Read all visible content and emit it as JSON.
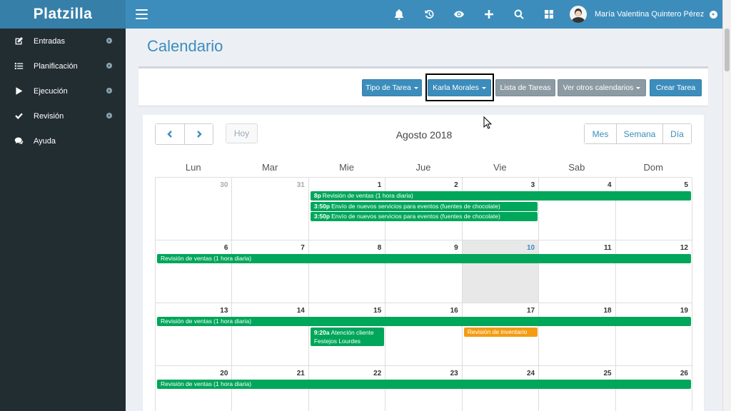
{
  "app": {
    "logo": "Platzilla"
  },
  "header": {
    "icons": [
      "bell-icon",
      "history-icon",
      "eye-icon",
      "plus-icon",
      "search-icon",
      "grid-icon"
    ],
    "user_name": "María Valentina Quintero Pérez"
  },
  "sidebar": {
    "items": [
      {
        "label": "Entradas",
        "icon": "edit-icon",
        "has_arrow": true
      },
      {
        "label": "Planificación",
        "icon": "list-icon",
        "has_arrow": true
      },
      {
        "label": "Ejecución",
        "icon": "play-icon",
        "has_arrow": true
      },
      {
        "label": "Revisión",
        "icon": "check-icon",
        "has_arrow": true
      },
      {
        "label": "Ayuda",
        "icon": "chat-icon",
        "has_arrow": false
      }
    ]
  },
  "page": {
    "title": "Calendario"
  },
  "toolbar": {
    "tipo_tarea": "Tipo de Tarea",
    "karla": "Karla Morales",
    "lista": "Lista de Tareas",
    "ver_otros": "Ver otros calendarios",
    "crear": "Crear Tarea"
  },
  "calendar": {
    "today_label": "Hoy",
    "month_title": "Agosto 2018",
    "views": {
      "month": "Mes",
      "week": "Semana",
      "day": "Día"
    },
    "days_of_week": [
      "Lun",
      "Mar",
      "Mie",
      "Jue",
      "Vie",
      "Sab",
      "Dom"
    ],
    "weeks": [
      {
        "days": [
          "30",
          "31",
          "1",
          "2",
          "3",
          "4",
          "5"
        ],
        "muted": [
          0,
          1
        ]
      },
      {
        "days": [
          "6",
          "7",
          "8",
          "9",
          "10",
          "11",
          "12"
        ],
        "today": 4
      },
      {
        "days": [
          "13",
          "14",
          "15",
          "16",
          "17",
          "18",
          "19"
        ]
      },
      {
        "days": [
          "20",
          "21",
          "22",
          "23",
          "24",
          "25",
          "26"
        ]
      }
    ],
    "events": [
      {
        "week": 0,
        "start": 2,
        "span": 5,
        "row": 0,
        "time": "8p",
        "title": "Revisión de ventas (1 hora diaria)",
        "color": "green"
      },
      {
        "week": 0,
        "start": 2,
        "span": 3,
        "row": 1,
        "time": "3:50p",
        "title": "Envío de nuevos servicios para eventos (fuentes de chocolate)",
        "color": "green"
      },
      {
        "week": 0,
        "start": 2,
        "span": 3,
        "row": 2,
        "time": "3:50p",
        "title": "Envío de nuevos servicios para eventos (fuentes de chocolate)",
        "color": "green"
      },
      {
        "week": 1,
        "start": 0,
        "span": 7,
        "row": 0,
        "time": "",
        "title": "Revisión de ventas (1 hora diaria)",
        "color": "green"
      },
      {
        "week": 2,
        "start": 0,
        "span": 7,
        "row": 0,
        "time": "",
        "title": "Revisión de ventas (1 hora diaria)",
        "color": "green"
      },
      {
        "week": 2,
        "start": 2,
        "span": 1,
        "row": 1,
        "time": "9:20a",
        "title": "Atención cliente Festejos Lourdes",
        "color": "green",
        "tall": true
      },
      {
        "week": 2,
        "start": 4,
        "span": 1,
        "row": 1,
        "time": "",
        "title": "Revisión de inventario",
        "color": "orange"
      },
      {
        "week": 3,
        "start": 0,
        "span": 7,
        "row": 0,
        "time": "",
        "title": "Revisión de ventas (1 hora diaria)",
        "color": "green"
      }
    ]
  }
}
